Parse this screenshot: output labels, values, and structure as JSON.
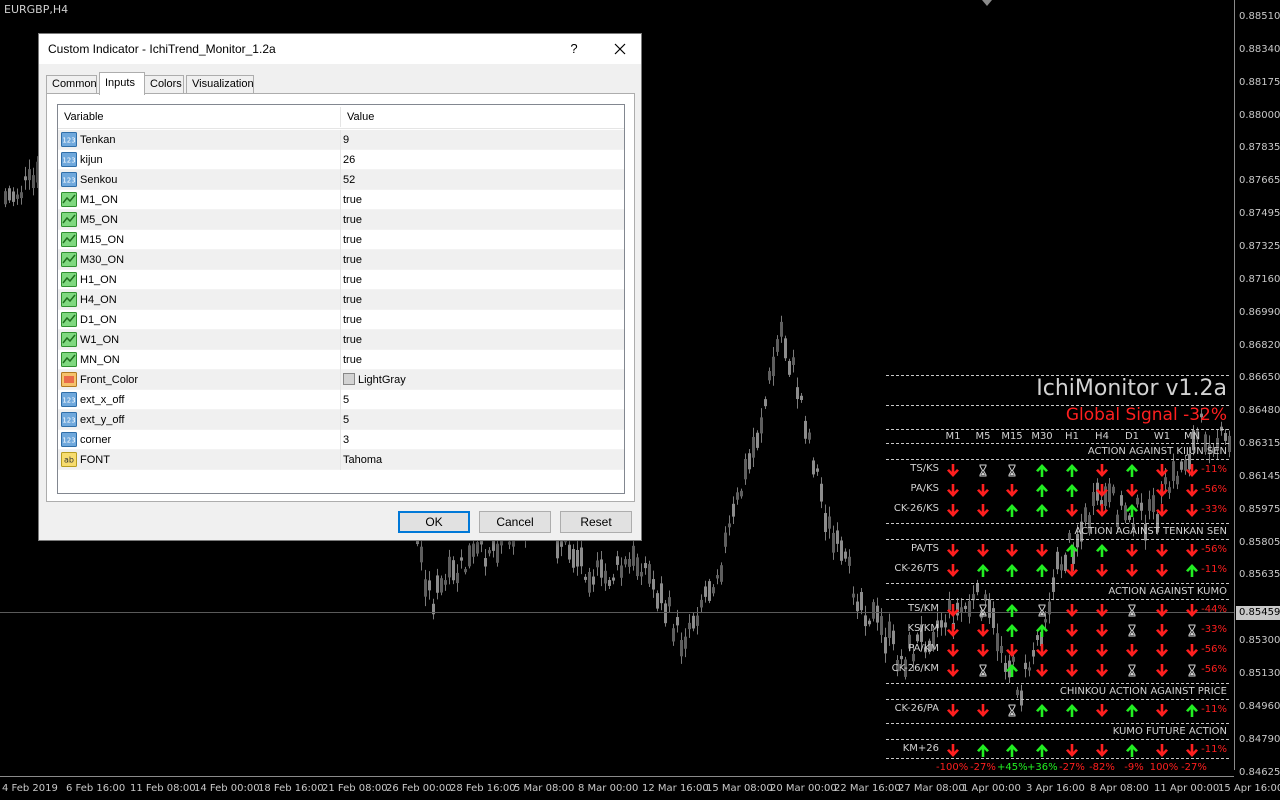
{
  "chart": {
    "symbol": "EURGBP,H4",
    "price_ticks": [
      "0.88510",
      "0.88340",
      "0.88175",
      "0.88000",
      "0.87835",
      "0.87665",
      "0.87495",
      "0.87325",
      "0.87160",
      "0.86990",
      "0.86820",
      "0.86650",
      "0.86480",
      "0.86315",
      "0.86145",
      "0.85975",
      "0.85805",
      "0.85635",
      "0.85459",
      "0.85300",
      "0.85130",
      "0.84960",
      "0.84790",
      "0.84625"
    ],
    "current_price": "0.85459",
    "time_ticks": [
      "4 Feb 2019",
      "6 Feb 16:00",
      "11 Feb 08:00",
      "14 Feb 00:00",
      "18 Feb 16:00",
      "21 Feb 08:00",
      "26 Feb 00:00",
      "28 Feb 16:00",
      "5 Mar 08:00",
      "8 Mar 00:00",
      "12 Mar 16:00",
      "15 Mar 08:00",
      "20 Mar 00:00",
      "22 Mar 16:00",
      "27 Mar 08:00",
      "1 Apr 00:00",
      "3 Apr 16:00",
      "8 Apr 08:00",
      "11 Apr 00:00",
      "15 Apr 16:00"
    ]
  },
  "monitor": {
    "title": "IchiMonitor v1.2a",
    "global_signal": "Global Signal -32%",
    "timeframes": [
      "M1",
      "M5",
      "M15",
      "M30",
      "H1",
      "H4",
      "D1",
      "W1",
      "MN"
    ],
    "sections": [
      {
        "title": "ACTION AGAINST KIJUN SEN",
        "rows": [
          {
            "label": "TS/KS",
            "cells": [
              "down",
              "hour",
              "hour",
              "up",
              "up",
              "down",
              "up",
              "down",
              "down"
            ],
            "pct": "-11%"
          },
          {
            "label": "PA/KS",
            "cells": [
              "down",
              "down",
              "down",
              "up",
              "up",
              "down",
              "down",
              "down",
              "down"
            ],
            "pct": "-56%"
          },
          {
            "label": "CK-26/KS",
            "cells": [
              "down",
              "down",
              "up",
              "up",
              "down",
              "down",
              "up",
              "down",
              "down"
            ],
            "pct": "-33%"
          }
        ]
      },
      {
        "title": "ACTION AGAINST TENKAN SEN",
        "rows": [
          {
            "label": "PA/TS",
            "cells": [
              "down",
              "down",
              "down",
              "down",
              "up",
              "up",
              "down",
              "down",
              "down"
            ],
            "pct": "-56%"
          },
          {
            "label": "CK-26/TS",
            "cells": [
              "down",
              "up",
              "up",
              "up",
              "down",
              "down",
              "down",
              "down",
              "up"
            ],
            "pct": "-11%"
          }
        ]
      },
      {
        "title": "ACTION AGAINST KUMO",
        "rows": [
          {
            "label": "TS/KM",
            "cells": [
              "down",
              "hour",
              "up",
              "hour",
              "down",
              "down",
              "hour",
              "down",
              "down"
            ],
            "pct": "-44%"
          },
          {
            "label": "KS/KM",
            "cells": [
              "down",
              "down",
              "up",
              "up",
              "down",
              "down",
              "hour",
              "down",
              "hour"
            ],
            "pct": "-33%"
          },
          {
            "label": "PA/KM",
            "cells": [
              "down",
              "down",
              "down",
              "down",
              "down",
              "down",
              "down",
              "down",
              "down"
            ],
            "pct": "-56%"
          },
          {
            "label": "CK-26/KM",
            "cells": [
              "down",
              "hour",
              "up",
              "down",
              "down",
              "down",
              "hour",
              "down",
              "hour"
            ],
            "pct": "-56%"
          }
        ]
      },
      {
        "title": "CHINKOU ACTION AGAINST PRICE",
        "rows": [
          {
            "label": "CK-26/PA",
            "cells": [
              "down",
              "down",
              "hour",
              "up",
              "up",
              "down",
              "up",
              "down",
              "up"
            ],
            "pct": "-11%"
          }
        ]
      },
      {
        "title": "KUMO FUTURE ACTION",
        "rows": [
          {
            "label": "KM+26",
            "cells": [
              "down",
              "up",
              "up",
              "up",
              "down",
              "down",
              "up",
              "down",
              "down"
            ],
            "pct": "-11%"
          }
        ]
      }
    ],
    "bottom_pcts": [
      {
        "text": "-100%",
        "color": "#ff1f1f"
      },
      {
        "text": "-27%",
        "color": "#ff1f1f"
      },
      {
        "text": "+45%",
        "color": "#22ee22"
      },
      {
        "text": "+36%",
        "color": "#22ee22"
      },
      {
        "text": "-27%",
        "color": "#ff1f1f"
      },
      {
        "text": "-82%",
        "color": "#ff1f1f"
      },
      {
        "text": "-9%",
        "color": "#ff1f1f"
      },
      {
        "text": "100%",
        "color": "#ff1f1f"
      },
      {
        "text": "-27%",
        "color": "#ff1f1f"
      }
    ],
    "colors": {
      "down": "#ff1f1f",
      "up": "#22ee22",
      "text": "#d3d3d3"
    }
  },
  "dialog": {
    "title": "Custom Indicator - IchiTrend_Monitor_1.2a",
    "help": "?",
    "tabs": [
      "Common",
      "Inputs",
      "Colors",
      "Visualization"
    ],
    "active_tab": "Inputs",
    "columns": {
      "variable": "Variable",
      "value": "Value"
    },
    "rows": [
      {
        "icon": "int-icon",
        "variable": "Tenkan",
        "value": "9"
      },
      {
        "icon": "int-icon",
        "variable": "kijun",
        "value": "26"
      },
      {
        "icon": "int-icon",
        "variable": "Senkou",
        "value": "52"
      },
      {
        "icon": "bool-icon",
        "variable": "M1_ON",
        "value": "true"
      },
      {
        "icon": "bool-icon",
        "variable": "M5_ON",
        "value": "true"
      },
      {
        "icon": "bool-icon",
        "variable": "M15_ON",
        "value": "true"
      },
      {
        "icon": "bool-icon",
        "variable": "M30_ON",
        "value": "true"
      },
      {
        "icon": "bool-icon",
        "variable": "H1_ON",
        "value": "true"
      },
      {
        "icon": "bool-icon",
        "variable": "H4_ON",
        "value": "true"
      },
      {
        "icon": "bool-icon",
        "variable": "D1_ON",
        "value": "true"
      },
      {
        "icon": "bool-icon",
        "variable": "W1_ON",
        "value": "true"
      },
      {
        "icon": "bool-icon",
        "variable": "MN_ON",
        "value": "true"
      },
      {
        "icon": "color-icon",
        "variable": "Front_Color",
        "value": "LightGray"
      },
      {
        "icon": "int-icon",
        "variable": "ext_x_off",
        "value": "5"
      },
      {
        "icon": "int-icon",
        "variable": "ext_y_off",
        "value": "5"
      },
      {
        "icon": "int-icon",
        "variable": "corner",
        "value": "3"
      },
      {
        "icon": "string-icon",
        "variable": "FONT",
        "value": "Tahoma"
      }
    ],
    "buttons": {
      "ok": "OK",
      "cancel": "Cancel",
      "reset": "Reset"
    }
  }
}
